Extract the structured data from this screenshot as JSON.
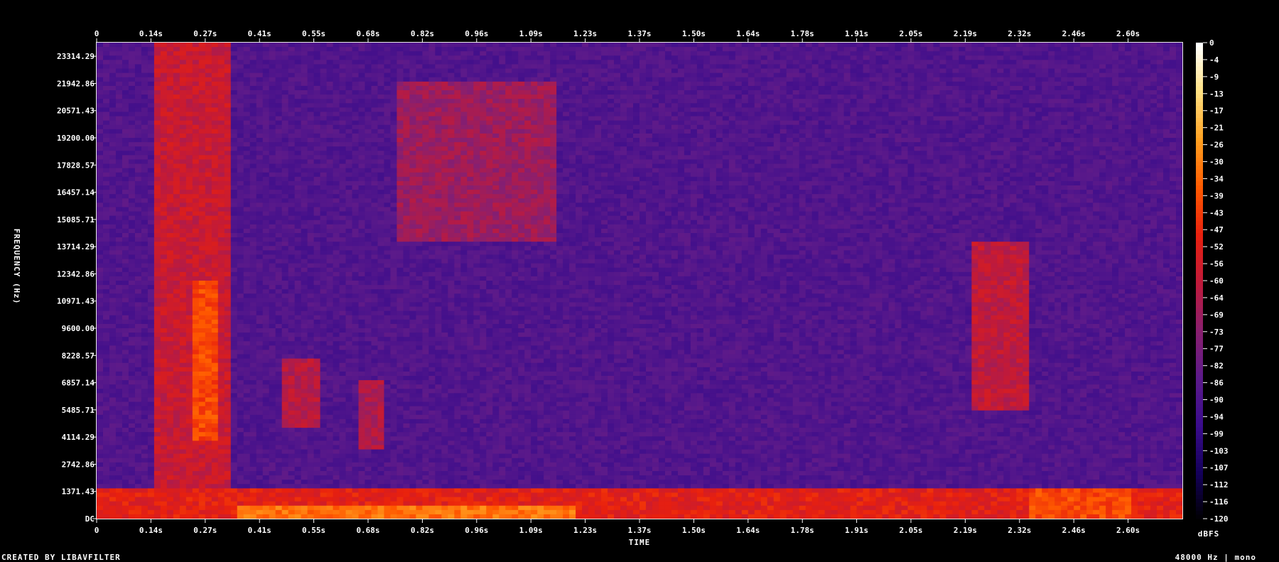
{
  "chart_data": {
    "type": "heatmap",
    "title": "",
    "xlabel": "TIME",
    "ylabel": "FREQUENCY (Hz)",
    "colorbar_label": "dBFS",
    "footer_left": "CREATED BY LIBAVFILTER",
    "footer_right": "48000 Hz | mono",
    "x_ticks": [
      "0",
      "0.14s",
      "0.27s",
      "0.41s",
      "0.55s",
      "0.68s",
      "0.82s",
      "0.96s",
      "1.09s",
      "1.23s",
      "1.37s",
      "1.50s",
      "1.64s",
      "1.78s",
      "1.91s",
      "2.05s",
      "2.19s",
      "2.32s",
      "2.46s",
      "2.60s"
    ],
    "y_ticks": [
      "DC",
      "1371.43",
      "2742.86",
      "4114.29",
      "5485.71",
      "6857.14",
      "8228.57",
      "9600.00",
      "10971.43",
      "12342.86",
      "13714.29",
      "15085.71",
      "16457.14",
      "17828.57",
      "19200.00",
      "20571.43",
      "21942.86",
      "23314.29"
    ],
    "y_tick_values": [
      0,
      1371.43,
      2742.86,
      4114.29,
      5485.71,
      6857.14,
      8228.57,
      9600.0,
      10971.43,
      12342.86,
      13714.29,
      15085.71,
      16457.14,
      17828.57,
      19200.0,
      20571.43,
      21942.86,
      23314.29
    ],
    "x_range": [
      0,
      2.73
    ],
    "y_range": [
      0,
      24000
    ],
    "colorbar_ticks": [
      "0",
      "-4",
      "-9",
      "-13",
      "-17",
      "-21",
      "-26",
      "-30",
      "-34",
      "-39",
      "-43",
      "-47",
      "-52",
      "-56",
      "-60",
      "-64",
      "-69",
      "-73",
      "-77",
      "-82",
      "-86",
      "-90",
      "-94",
      "-99",
      "-103",
      "-107",
      "-112",
      "-116",
      "-120"
    ],
    "colorbar_range": [
      -120,
      0
    ],
    "colormap": [
      "#000000",
      "#14005a",
      "#3a0c8c",
      "#5c1a8a",
      "#8a1f6e",
      "#c01a3a",
      "#e8200e",
      "#ff5a00",
      "#ffa020",
      "#ffe080",
      "#ffffff"
    ],
    "background_level_db": -88,
    "energy_regions": [
      {
        "t0": 0.14,
        "t1": 0.33,
        "f0": 0,
        "f1": 24000,
        "db": -58
      },
      {
        "t0": 0.24,
        "t1": 0.31,
        "f0": 4000,
        "f1": 12000,
        "db": -40
      },
      {
        "t0": 0.46,
        "t1": 0.56,
        "f0": 4500,
        "f1": 8000,
        "db": -62
      },
      {
        "t0": 0.66,
        "t1": 0.72,
        "f0": 3500,
        "f1": 7000,
        "db": -64
      },
      {
        "t0": 0.75,
        "t1": 1.15,
        "f0": 14000,
        "f1": 22000,
        "db": -68
      },
      {
        "t0": 2.2,
        "t1": 2.35,
        "f0": 5500,
        "f1": 14000,
        "db": -60
      },
      {
        "t0": 0.0,
        "t1": 2.73,
        "f0": 0,
        "f1": 1600,
        "db": -50
      },
      {
        "t0": 0.35,
        "t1": 1.2,
        "f0": 0,
        "f1": 700,
        "db": -32
      },
      {
        "t0": 2.35,
        "t1": 2.6,
        "f0": 0,
        "f1": 1500,
        "db": -40
      }
    ]
  }
}
